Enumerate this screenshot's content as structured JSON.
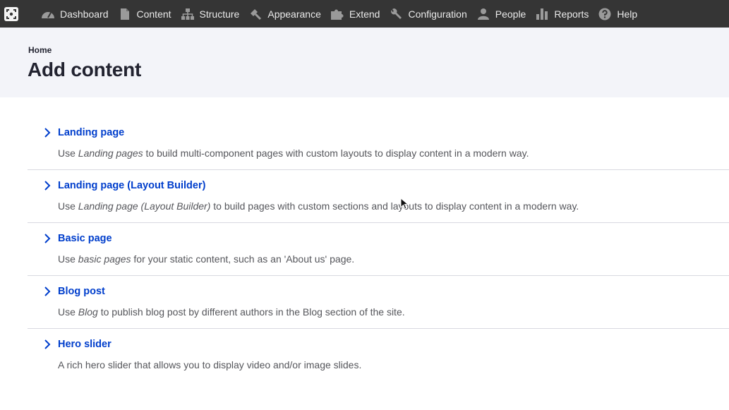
{
  "toolbar": {
    "home_icon": "drupal-home-icon",
    "items": [
      {
        "label": "Dashboard",
        "icon": "dashboard-icon"
      },
      {
        "label": "Content",
        "icon": "document-icon"
      },
      {
        "label": "Structure",
        "icon": "structure-icon"
      },
      {
        "label": "Appearance",
        "icon": "brush-icon"
      },
      {
        "label": "Extend",
        "icon": "puzzle-icon"
      },
      {
        "label": "Configuration",
        "icon": "wrench-icon"
      },
      {
        "label": "People",
        "icon": "person-icon"
      },
      {
        "label": "Reports",
        "icon": "bar-chart-icon"
      },
      {
        "label": "Help",
        "icon": "help-icon"
      }
    ]
  },
  "header": {
    "breadcrumb": "Home",
    "title": "Add content"
  },
  "content_types": [
    {
      "title": "Landing page",
      "desc_before": "Use ",
      "desc_em": "Landing pages",
      "desc_after": " to build multi-component pages with custom layouts to display content in a modern way."
    },
    {
      "title": "Landing page (Layout Builder)",
      "desc_before": "Use ",
      "desc_em": "Landing page (Layout Builder)",
      "desc_after": " to build pages with custom sections and layouts to display content in a modern way."
    },
    {
      "title": "Basic page",
      "desc_before": "Use ",
      "desc_em": "basic pages",
      "desc_after": " for your static content, such as an 'About us' page."
    },
    {
      "title": "Blog post",
      "desc_before": "Use ",
      "desc_em": "Blog",
      "desc_after": " to publish blog post by different authors in the Blog section of the site."
    },
    {
      "title": "Hero slider",
      "desc_before": "A rich hero slider that allows you to display video and/or image slides.",
      "desc_em": "",
      "desc_after": ""
    }
  ],
  "colors": {
    "toolbar_bg": "#353535",
    "header_bg": "#f3f4f9",
    "link": "#003ecc",
    "text": "#222330",
    "muted": "#55565b"
  }
}
